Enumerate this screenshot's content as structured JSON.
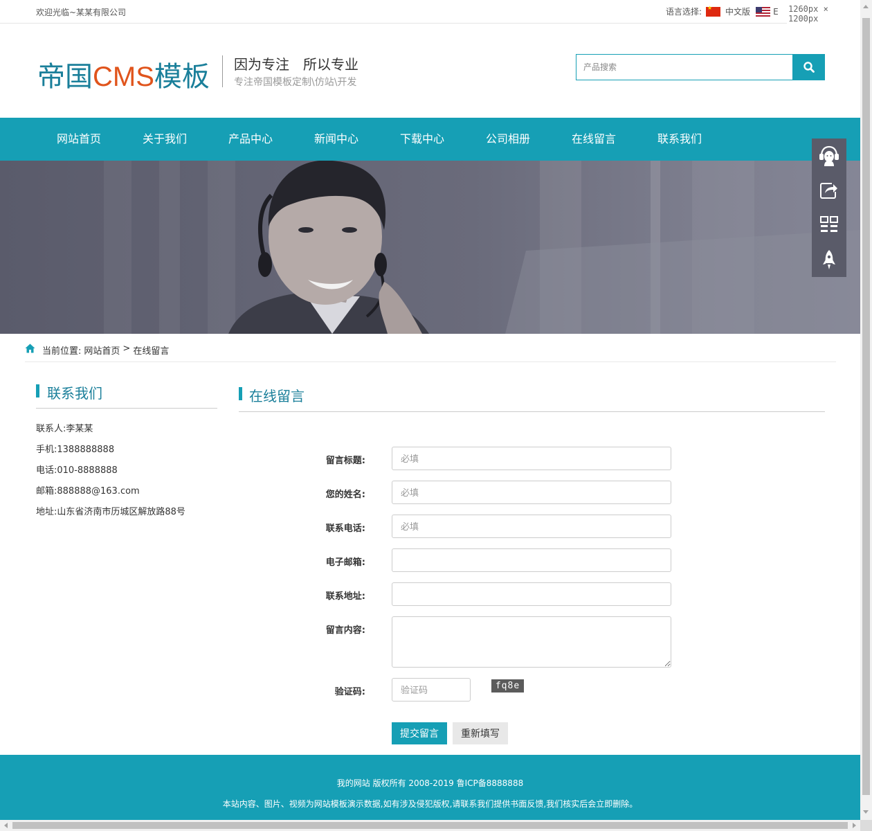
{
  "topbar": {
    "welcome": "欢迎光临~某某有限公司",
    "lang_label": "语言选择:",
    "lang_cn": "中文版",
    "lang_en": "E",
    "dimension_label": "1260px × 1200px"
  },
  "header": {
    "logo_main": "帝国",
    "logo_cms": "CMS",
    "logo_tail": "模板",
    "slogan": "因为专注　所以专业",
    "subslogan": "专注帝国模板定制\\仿站\\开发",
    "search_placeholder": "产品搜索",
    "search_icon": "search-icon"
  },
  "nav": {
    "items": [
      {
        "label": "网站首页"
      },
      {
        "label": "关于我们"
      },
      {
        "label": "产品中心"
      },
      {
        "label": "新闻中心"
      },
      {
        "label": "下载中心"
      },
      {
        "label": "公司相册"
      },
      {
        "label": "在线留言"
      },
      {
        "label": "联系我们"
      }
    ]
  },
  "sidefloat": {
    "icons": [
      "headset-icon",
      "share-icon",
      "qrcode-icon",
      "rocket-icon"
    ]
  },
  "breadcrumb": {
    "prefix": "当前位置:",
    "home": "网站首页",
    "sep": ">",
    "current": "在线留言"
  },
  "sidebar": {
    "title": "联系我们",
    "contact": [
      {
        "text": "联系人:李某某"
      },
      {
        "text": "手机:1388888888"
      },
      {
        "text": "电话:010-8888888"
      },
      {
        "text": "邮箱:888888@163.com"
      },
      {
        "text": "地址:山东省济南市历城区解放路88号"
      }
    ]
  },
  "main": {
    "title": "在线留言",
    "form": {
      "subject_label": "留言标题:",
      "subject_placeholder": "必填",
      "name_label": "您的姓名:",
      "name_placeholder": "必填",
      "phone_label": "联系电话:",
      "phone_placeholder": "必填",
      "email_label": "电子邮箱:",
      "address_label": "联系地址:",
      "content_label": "留言内容:",
      "captcha_label": "验证码:",
      "captcha_placeholder": "验证码",
      "captcha_text": "fq8e",
      "submit_label": "提交留言",
      "reset_label": "重新填写"
    }
  },
  "footer": {
    "line1": "我的网站 版权所有 2008-2019 鲁ICP备8888888",
    "line2": "本站内容、图片、视频为网站模板演示数据,如有涉及侵犯版权,请联系我们提供书面反馈,我们核实后会立即删除。"
  },
  "colors": {
    "accent": "#169fb5",
    "logo_teal": "#1a7f9a",
    "logo_orange": "#e0541c",
    "banner_gray": "#636474"
  }
}
